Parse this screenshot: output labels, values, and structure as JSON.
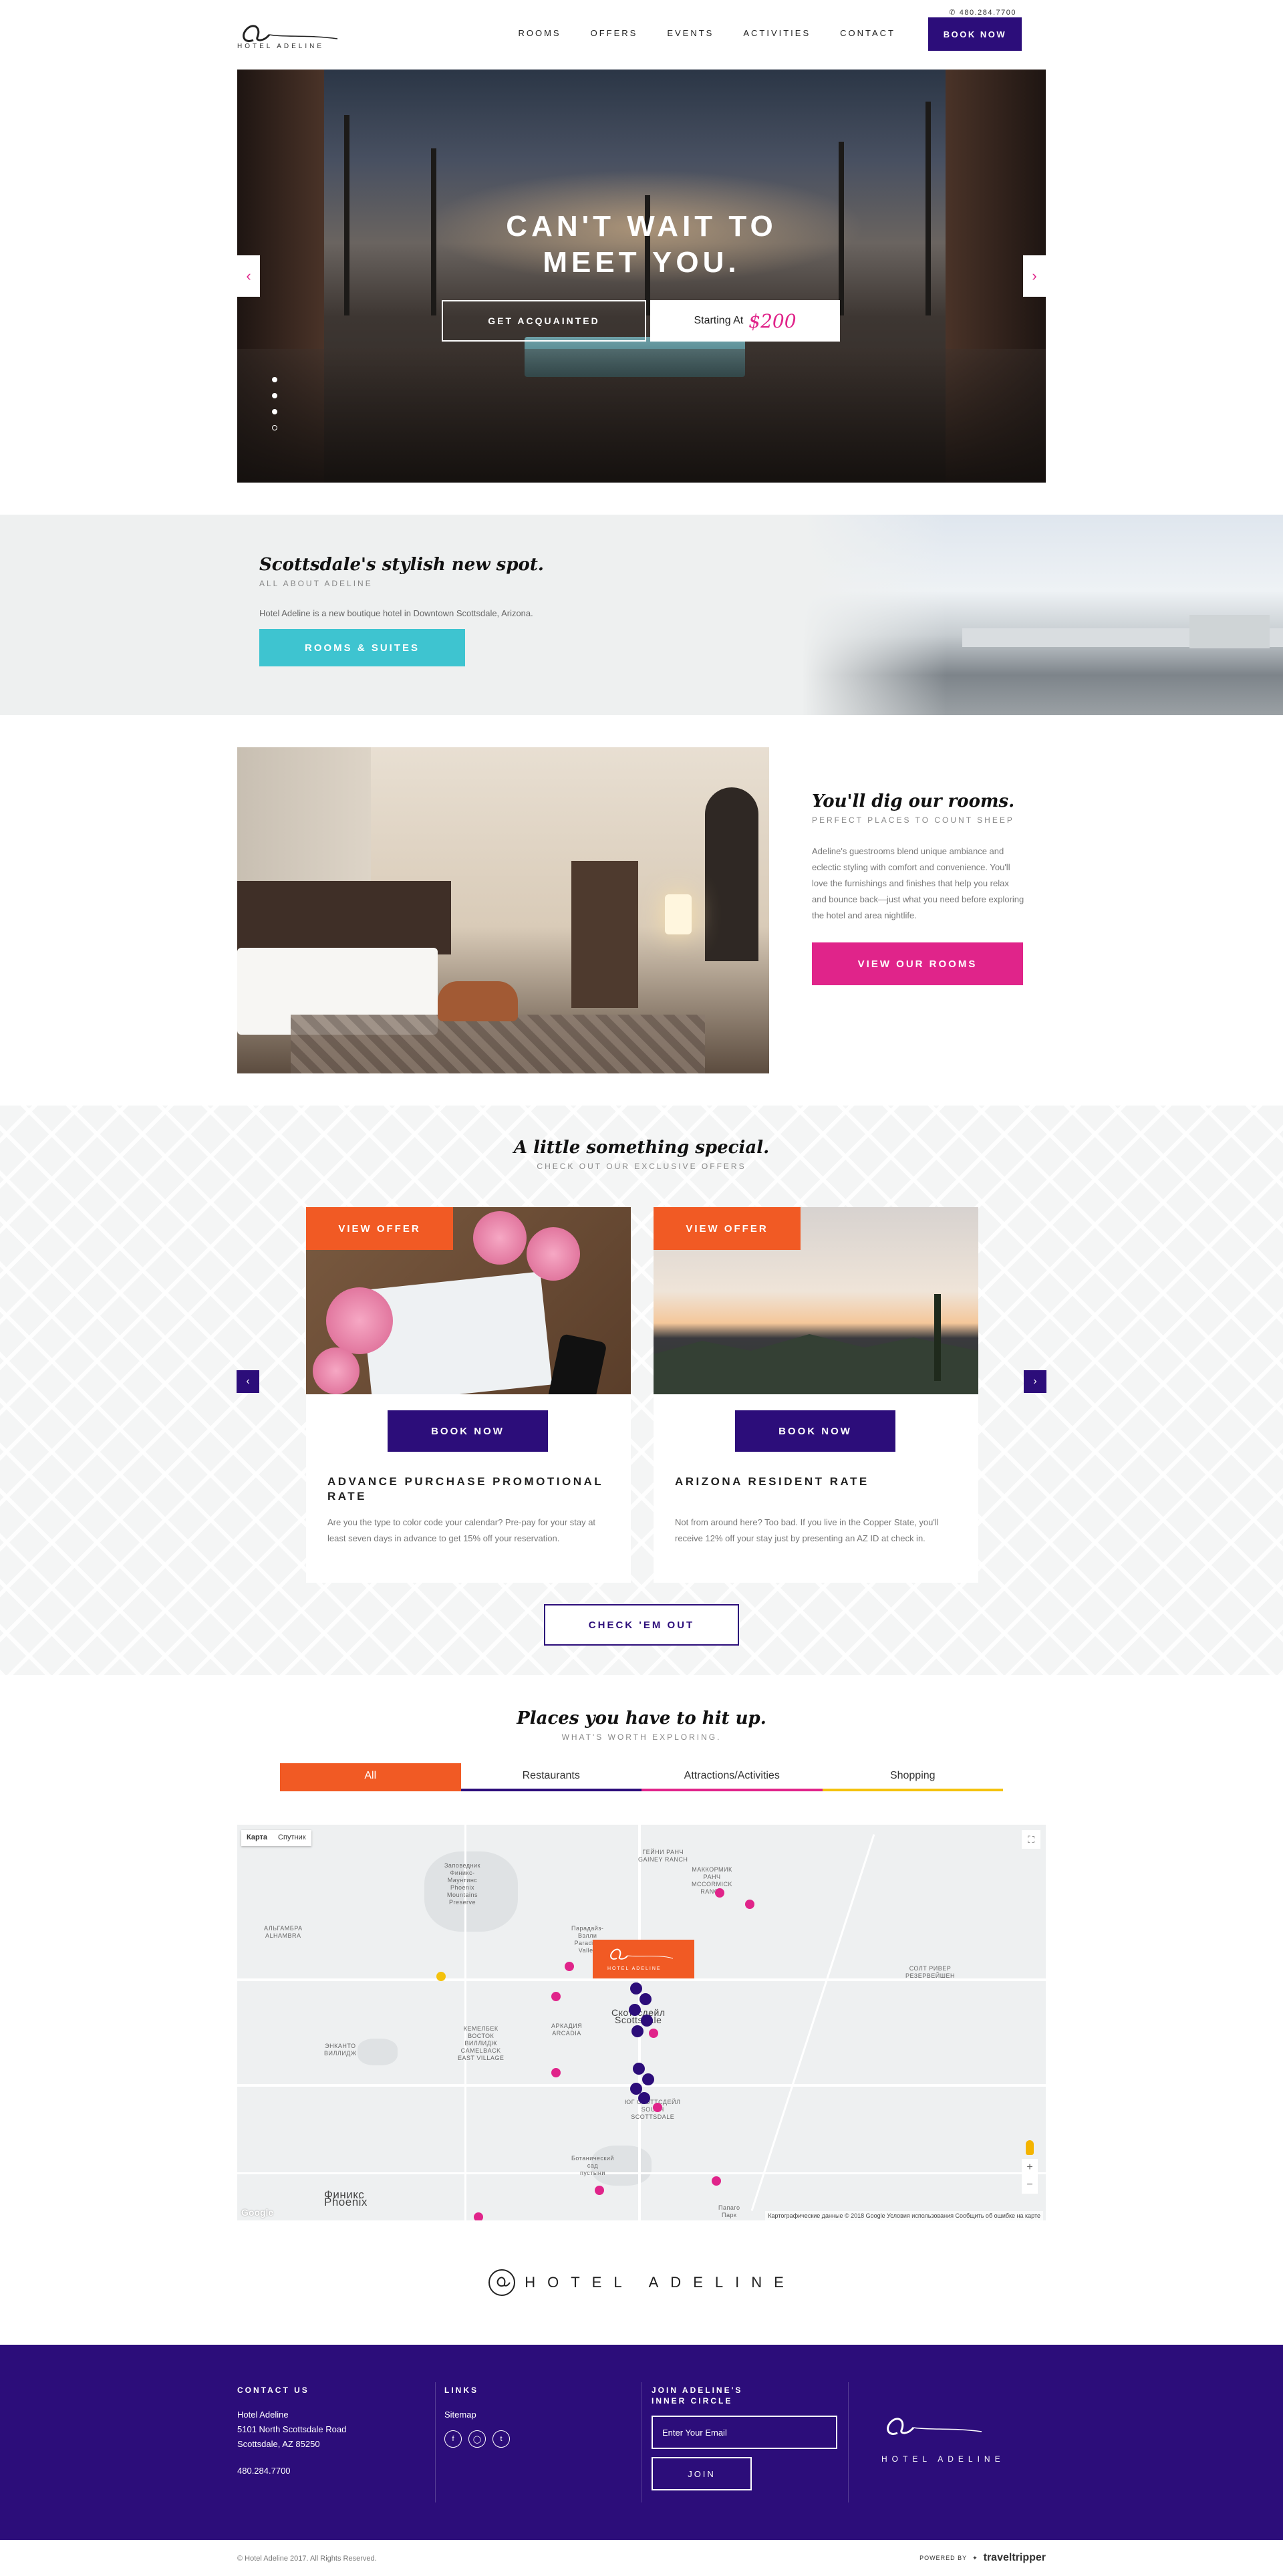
{
  "header": {
    "logo_text": "HOTEL ADELINE",
    "phone": "480.284.7700",
    "nav": [
      "ROOMS",
      "OFFERS",
      "EVENTS",
      "ACTIVITIES",
      "CONTACT"
    ],
    "book_label": "BOOK NOW"
  },
  "hero": {
    "title_line1": "CAN'T WAIT TO",
    "title_line2": "MEET YOU.",
    "cta_label": "GET ACQUAINTED",
    "price_prefix": "Starting At",
    "price": "$200",
    "prev_icon": "chevron-left-icon",
    "next_icon": "chevron-right-icon"
  },
  "about": {
    "title": "Scottsdale's stylish new spot.",
    "subtitle": "ALL ABOUT ADELINE",
    "text": "Hotel Adeline is a new boutique hotel in Downtown Scottsdale, Arizona.",
    "button": "ROOMS & SUITES"
  },
  "rooms": {
    "title": "You'll dig our rooms.",
    "subtitle": "PERFECT PLACES TO COUNT SHEEP",
    "text": "Adeline's guestrooms blend unique ambiance and eclectic styling with comfort and convenience. You'll love the furnishings and finishes that help you relax and bounce back—just what you need before exploring the hotel and area nightlife.",
    "button": "VIEW OUR ROOMS"
  },
  "offers": {
    "title": "A little something special.",
    "subtitle": "CHECK OUT OUR EXCLUSIVE OFFERS",
    "cards": [
      {
        "tag": "VIEW OFFER",
        "book": "BOOK NOW",
        "title": "ADVANCE PURCHASE PROMOTIONAL RATE",
        "text": "Are you the type to color code your calendar? Pre-pay for your stay at least seven days in advance to get 15% off your reservation."
      },
      {
        "tag": "VIEW OFFER",
        "book": "BOOK NOW",
        "title": "ARIZONA RESIDENT RATE",
        "text": "Not from around here? Too bad. If you live in the Copper State, you'll receive 12% off your stay just by presenting an AZ ID at check in."
      }
    ],
    "button": "CHECK 'EM OUT"
  },
  "places": {
    "title": "Places you have to hit up.",
    "subtitle": "WHAT'S WORTH EXPLORING.",
    "tabs": [
      {
        "label": "All",
        "color": "#f15a24"
      },
      {
        "label": "Restaurants",
        "color": "#2c0d7a"
      },
      {
        "label": "Attractions/Activities",
        "color": "#e0248a"
      },
      {
        "label": "Shopping",
        "color": "#f4c20d"
      }
    ]
  },
  "map": {
    "map_type": [
      "Карта",
      "Спутник"
    ],
    "labels": {
      "gainey": "ГЕЙНИ РАНЧ\nGAINEY RANCH",
      "mccormick": "МАККОРМИК\nРАНЧ\nMCCORMICK\nRANCH",
      "paradise": "Парадайз-\nВэлли\nParadise\nValley",
      "phoenix_mtns": "Заповедник\nФиникс-\nМаунтинс\nPhoenix\nMountains\nPreserve",
      "alhambra": "АЛЬГАМБРА\nALHAMBRA",
      "salt_river": "СОЛТ РИВЕР\nРЕЗЕРВЕЙШЕН",
      "encanto": "ЭНКАНТО\nВИЛЛИДЖ",
      "camelback": "КЕМЕЛБЕК\nВОСТОК\nВИЛЛИДЖ\nCAMELBACK\nEAST VILLAGE",
      "arcadia": "АРКАДИЯ\nARCADIA",
      "scottsdale": "Скоттсдейл\nScottsdale",
      "north_scottsdale": "ЮГ СКОТТСДЕЙЛ\nSOUTH\nSCOTTSDALE",
      "phoenix": "Финикс\nPhoenix",
      "tempe": "Ботанический\nсад\nпустыни",
      "papago": "Папаго\nПарк"
    },
    "attribution": "Картографические данные © 2018 Google   Условия использования   Сообщить об ошибке на карте",
    "google": "Google",
    "pin_text": "HOTEL ADELINE"
  },
  "brand": {
    "name": "HOTEL ADELINE"
  },
  "footer": {
    "contact_heading": "CONTACT US",
    "contact_name": "Hotel Adeline",
    "address1": "5101 North Scottsdale Road",
    "address2": "Scottsdale, AZ 85250",
    "phone": "480.284.7700",
    "links_heading": "LINKS",
    "sitemap": "Sitemap",
    "social_icons": [
      "facebook-icon",
      "instagram-icon",
      "twitter-icon"
    ],
    "join_heading_1": "JOIN ADELINE'S",
    "join_heading_2": "INNER CIRCLE",
    "email_placeholder": "Enter Your Email",
    "join_button": "JOIN",
    "logo_text": "HOTEL ADELINE"
  },
  "bottom": {
    "copyright": "© Hotel Adeline 2017. All Rights Reserved.",
    "powered_by": "POWERED BY",
    "vendor": "traveltripper"
  },
  "colors": {
    "purple": "#2c0d7a",
    "pink": "#e0248a",
    "orange": "#f15a24",
    "teal": "#3ec4d0",
    "yellow": "#f4c20d"
  }
}
